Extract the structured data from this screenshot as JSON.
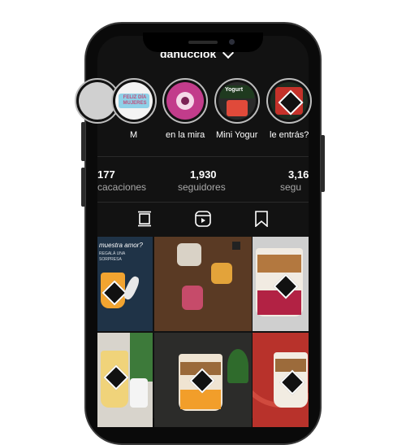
{
  "profile": {
    "username": "danucciok"
  },
  "highlights": [
    {
      "label": "",
      "ring": "#cfcfcf"
    },
    {
      "label": "M",
      "ring": "#cfcfcf"
    },
    {
      "label": "en la mira",
      "ring": "#cfcfcf"
    },
    {
      "label": "Mini Yogur",
      "ring": "#cfcfcf"
    },
    {
      "label": "le entrás?",
      "ring": "#cfcfcf"
    }
  ],
  "highlight_text": {
    "m_cover": "FELIZ DÍA MUJERES",
    "yogur_cover": "Yogurt"
  },
  "stats": [
    {
      "value": "177",
      "label": "cacaciones"
    },
    {
      "value": "1,930",
      "label": "seguidores"
    },
    {
      "value": "3,16",
      "label": "segu"
    }
  ],
  "tabs": [
    {
      "icon": "grid-icon"
    },
    {
      "icon": "reels-icon"
    },
    {
      "icon": "saved-icon"
    }
  ],
  "posts": {
    "p1_text": "muestra amor?",
    "p1_sub": "REGALÁ UNA SORPRESA"
  },
  "colors": {
    "background": "#121212",
    "text": "#ffffff",
    "muted": "#a8a8a8"
  }
}
